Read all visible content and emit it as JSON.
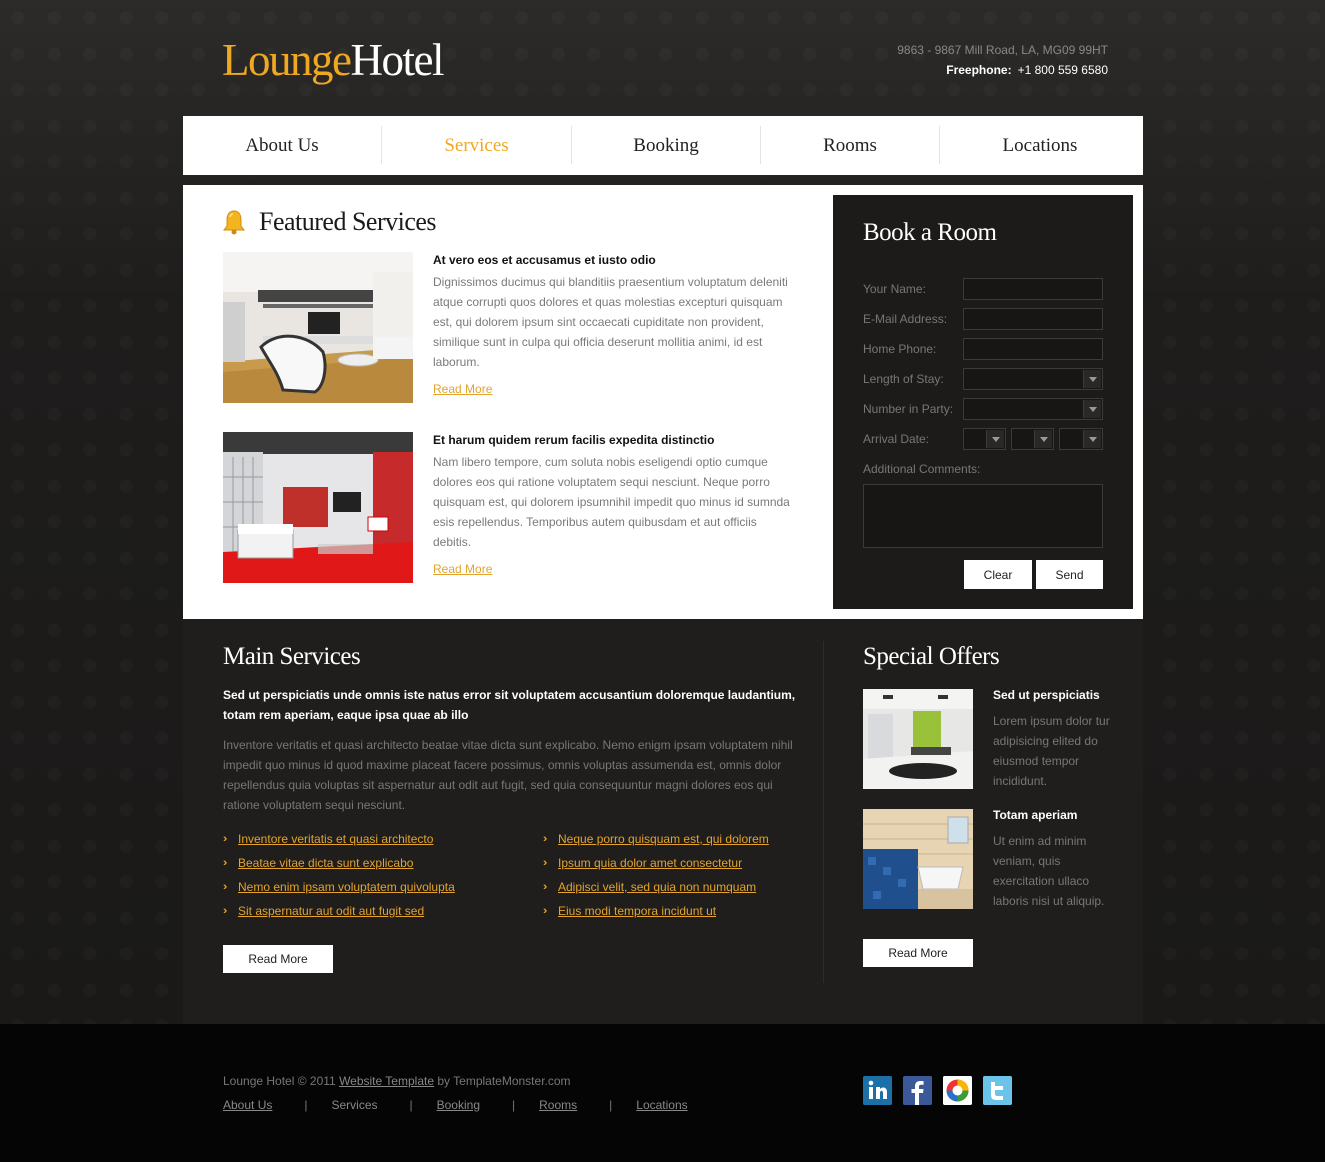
{
  "header": {
    "logo_part1": "Lounge",
    "logo_part2": "Hotel",
    "address": "9863 - 9867 Mill Road, LA, MG09 99HT",
    "phone_label": "Freephone:",
    "phone": "+1 800 559 6580"
  },
  "nav": [
    {
      "label": "About Us"
    },
    {
      "label": "Services"
    },
    {
      "label": "Booking"
    },
    {
      "label": "Rooms"
    },
    {
      "label": "Locations"
    }
  ],
  "featured": {
    "title": "Featured Services",
    "items": [
      {
        "heading": "At vero eos et accusamus et iusto odio",
        "text": "Dignissimos ducimus qui blanditiis praesentium voluptatum deleniti atque corrupti quos dolores et quas molestias excepturi quisquam est, qui dolorem ipsum sint occaecati cupiditate non provident, similique sunt in culpa qui officia deserunt mollitia animi, id est laborum.",
        "link": "Read More"
      },
      {
        "heading": "Et harum quidem rerum facilis expedita distinctio",
        "text": "Nam libero tempore, cum soluta nobis eseligendi optio cumque dolores eos qui ratione voluptatem sequi nesciunt. Neque porro quisquam est, qui dolorem ipsumnihil impedit quo minus id sumnda esis repellendus. Temporibus autem quibusdam et aut officiis debitis.",
        "link": "Read More"
      }
    ]
  },
  "booking": {
    "title": "Book a Room",
    "name_label": "Your Name:",
    "email_label": "E-Mail Address:",
    "phone_label": "Home Phone:",
    "stay_label": "Length of Stay:",
    "party_label": "Number in Party:",
    "arrival_label": "Arrival Date:",
    "comments_label": "Additional Comments:",
    "clear_label": "Clear",
    "send_label": "Send"
  },
  "main_services": {
    "title": "Main Services",
    "bold": "Sed ut perspiciatis unde omnis iste natus error sit voluptatem accusantium doloremque laudantium, totam rem aperiam, eaque ipsa quae ab illo",
    "para": "Inventore veritatis et quasi architecto beatae vitae dicta sunt explicabo. Nemo enigm ipsam voluptatem nihil impedit quo minus id quod maxime placeat facere possimus, omnis voluptas assumenda est, omnis dolor repellendus quia voluptas sit aspernatur aut odit aut fugit, sed quia consequuntur magni dolores eos qui ratione voluptatem sequi nesciunt.",
    "links_left": [
      "Inventore veritatis et quasi architecto",
      "Beatae vitae dicta sunt explicabo",
      "Nemo enim ipsam voluptatem quivolupta",
      "Sit aspernatur aut odit aut fugit sed"
    ],
    "links_right": [
      "Neque porro quisquam est, qui dolorem",
      "Ipsum quia dolor amet consectetur",
      "Adipisci velit, sed quia non numquam",
      "Eius modi tempora incidunt ut"
    ],
    "button": "Read More"
  },
  "special_offers": {
    "title": "Special Offers",
    "items": [
      {
        "heading": "Sed ut perspiciatis",
        "text": "Lorem ipsum dolor tur adipisicing elited do eiusmod tempor incididunt."
      },
      {
        "heading": "Totam aperiam",
        "text": "Ut enim ad minim veniam, quis exercitation ullaco laboris nisi ut aliquip."
      }
    ],
    "button": "Read More"
  },
  "footer": {
    "copy_prefix": "Lounge Hotel © 2011",
    "copy_link": "Website Template",
    "copy_suffix": "by TemplateMonster.com",
    "links": [
      "About Us",
      "Services",
      "Booking",
      "Rooms",
      "Locations"
    ],
    "separator": "|"
  },
  "social": [
    "linkedin-icon",
    "facebook-icon",
    "picasa-icon",
    "twitter-icon"
  ],
  "colors": {
    "accent": "#f0a821",
    "dark": "#1c1b1a",
    "link": "#e4a32c"
  }
}
